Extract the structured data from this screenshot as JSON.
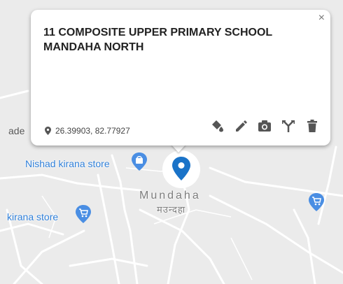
{
  "popup": {
    "title": "11 COMPOSITE UPPER PRIMARY SCHOOL MANDAHA NORTH",
    "coordinates": "26.39903, 82.77927",
    "close_label": "×",
    "tools": [
      "paint-bucket-icon",
      "pencil-icon",
      "camera-icon",
      "route-fork-icon",
      "trash-icon"
    ]
  },
  "map": {
    "partial_label": "ade",
    "place_name": "Mundaha",
    "place_name_hindi": "मउन्दहा",
    "pois": [
      {
        "name": "Nishad kirana store",
        "icon": "shopping-bag-icon"
      },
      {
        "name": "kirana store",
        "icon": "shopping-cart-icon"
      }
    ],
    "extra_poi_icon": "shopping-cart-icon"
  },
  "colors": {
    "marker": "#1a73c8",
    "poi": "#4a8ee3",
    "road": "#ffffff",
    "map_bg": "#ebebeb"
  }
}
